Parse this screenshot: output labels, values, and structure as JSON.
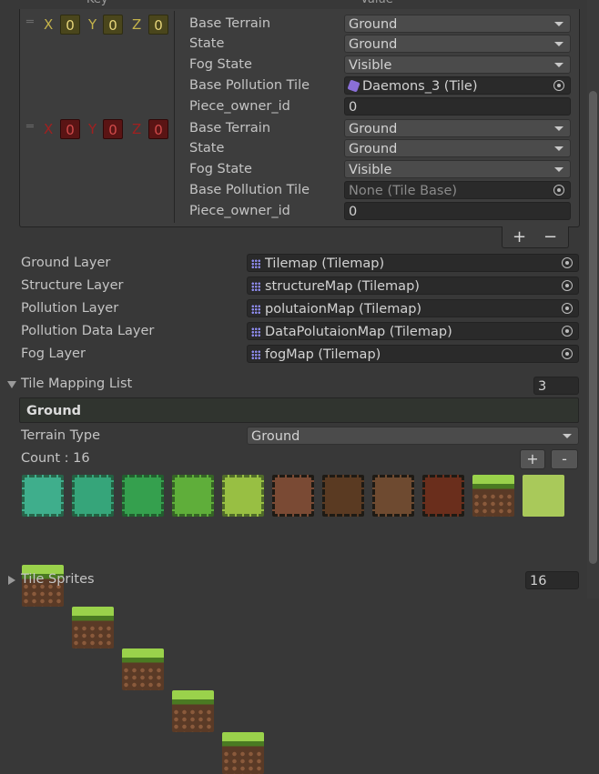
{
  "header": {
    "key_label": "Key",
    "value_label": "Value"
  },
  "entries": [
    {
      "coords": {
        "x_label": "X",
        "x": "0",
        "y_label": "Y",
        "y": "0",
        "z_label": "Z",
        "z": "0"
      },
      "rows": [
        {
          "label": "Base Terrain",
          "value": "Ground"
        },
        {
          "label": "State",
          "value": "Ground"
        },
        {
          "label": "Fog State",
          "value": "Visible"
        },
        {
          "label": "Base Pollution Tile",
          "value": "Daemons_3 (Tile)"
        },
        {
          "label": "Piece_owner_id",
          "value": "0"
        }
      ]
    },
    {
      "coords": {
        "x_label": "X",
        "x": "0",
        "y_label": "Y",
        "y": "0",
        "z_label": "Z",
        "z": "0"
      },
      "rows": [
        {
          "label": "Base Terrain",
          "value": "Ground"
        },
        {
          "label": "State",
          "value": "Ground"
        },
        {
          "label": "Fog State",
          "value": "Visible"
        },
        {
          "label": "Base Pollution Tile",
          "value": "None (Tile Base)"
        },
        {
          "label": "Piece_owner_id",
          "value": "0"
        }
      ]
    }
  ],
  "dict_buttons": {
    "add": "+",
    "remove": "−"
  },
  "layers": [
    {
      "label": "Ground Layer",
      "value": "Tilemap (Tilemap)"
    },
    {
      "label": "Structure Layer",
      "value": "structureMap (Tilemap)"
    },
    {
      "label": "Pollution Layer",
      "value": "polutaionMap (Tilemap)"
    },
    {
      "label": "Pollution Data Layer",
      "value": "DataPolutaionMap (Tilemap)"
    },
    {
      "label": "Fog Layer",
      "value": "fogMap (Tilemap)"
    }
  ],
  "tile_mapping": {
    "label": "Tile Mapping List",
    "size": "3",
    "element_title": "Ground",
    "terrain_type_label": "Terrain Type",
    "terrain_type_value": "Ground",
    "count_label": "Count : 16",
    "add": "+",
    "remove": "-"
  },
  "sprites": [
    {
      "color": "#3fae8c"
    },
    {
      "color": "#36a57a"
    },
    {
      "color": "#35a04e"
    },
    {
      "color": "#5fae3a"
    },
    {
      "color": "#98bf43"
    },
    {
      "color": "#7a4a34"
    },
    {
      "color": "#5a3a22"
    },
    {
      "color": "#6e4a30"
    },
    {
      "color": "#6a2e1c"
    },
    {
      "color": "grass"
    },
    {
      "color": "#a9c95a"
    },
    {
      "color": "grass"
    },
    {
      "color": "grass"
    },
    {
      "color": "grass"
    },
    {
      "color": "grass"
    },
    {
      "color": "grass"
    }
  ],
  "tile_sprites": {
    "label": "Tile Sprites",
    "value": "16"
  }
}
